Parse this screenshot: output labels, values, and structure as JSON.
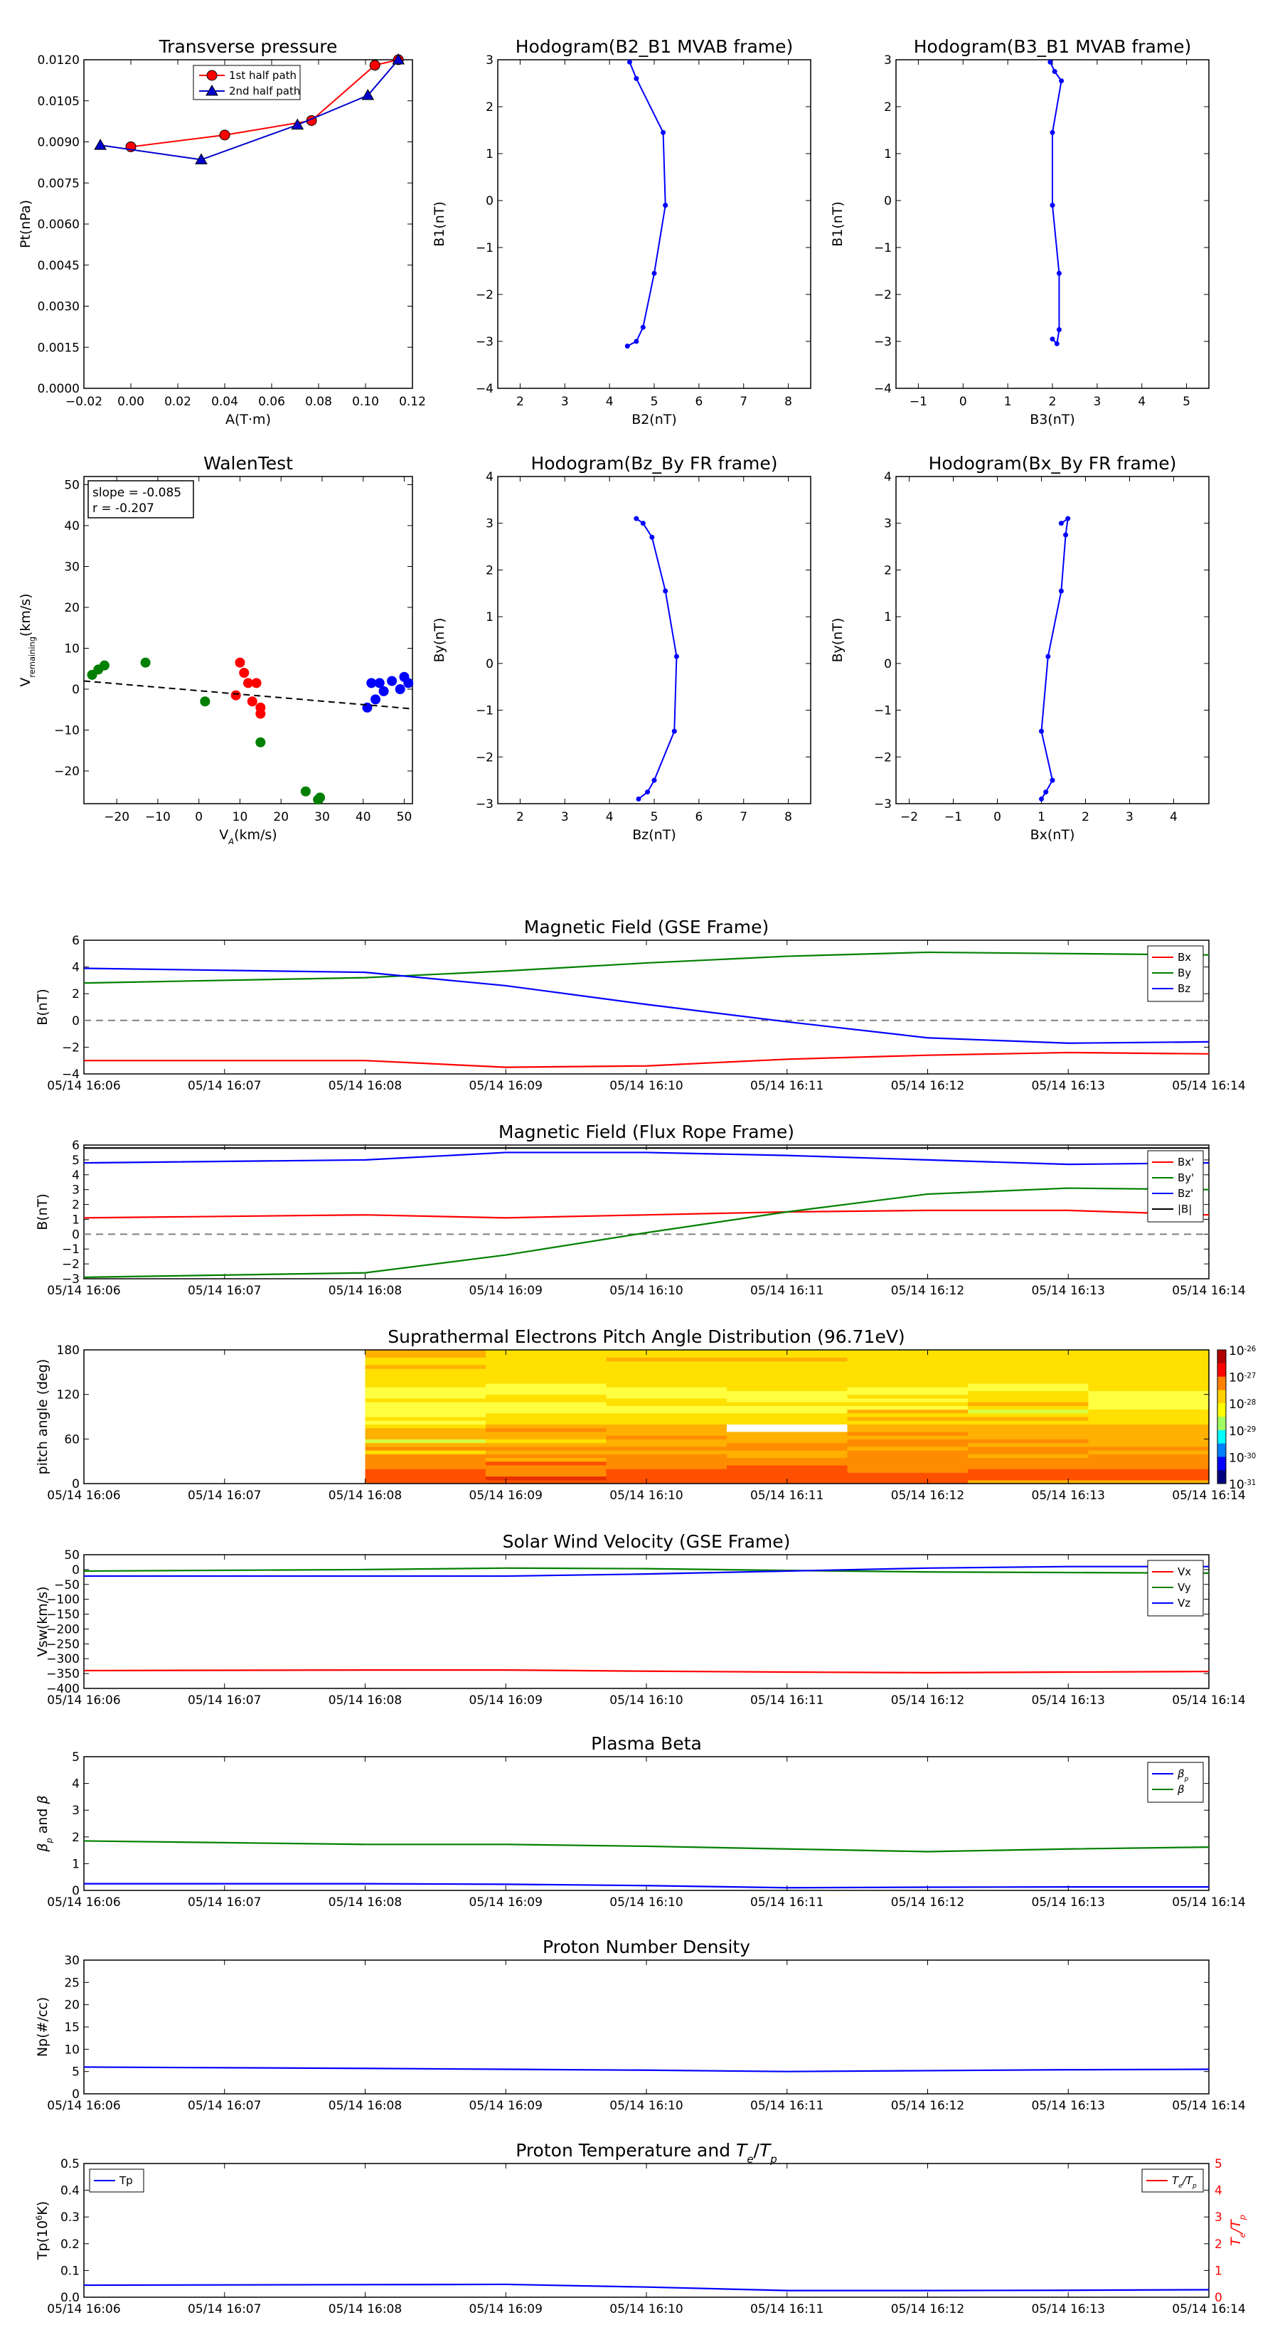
{
  "chart_data": [
    {
      "id": "tp",
      "type": "line",
      "title": "Transverse pressure",
      "xlabel": "A(T·m)",
      "ylabel": "Pt(nPa)",
      "xlim": [
        -0.02,
        0.12
      ],
      "ylim": [
        0,
        0.012
      ],
      "xticks": [
        "−0.02",
        "0.00",
        "0.02",
        "0.04",
        "0.06",
        "0.08",
        "0.10",
        "0.12"
      ],
      "yticks": [
        "0.0000",
        "0.0015",
        "0.0030",
        "0.0045",
        "0.0060",
        "0.0075",
        "0.0090",
        "0.0105",
        "0.0120"
      ],
      "legend": "top-center",
      "series": [
        {
          "name": "1st half path",
          "color": "#ff0000",
          "marker": "circle",
          "x": [
            0.0,
            0.04,
            0.077,
            0.104,
            0.114
          ],
          "y": [
            0.00882,
            0.00925,
            0.00978,
            0.0118,
            0.012
          ]
        },
        {
          "name": "2nd half path",
          "color": "#0000cc",
          "marker": "triangle",
          "x": [
            -0.013,
            0.03,
            0.071,
            0.101,
            0.114
          ],
          "y": [
            0.00888,
            0.00835,
            0.00962,
            0.0107,
            0.012
          ]
        }
      ]
    },
    {
      "id": "hodo1",
      "type": "line",
      "title": "Hodogram(B2_B1 MVAB frame)",
      "xlabel": "B2(nT)",
      "ylabel": "B1(nT)",
      "xlim": [
        1.5,
        8.5
      ],
      "ylim": [
        -4,
        3
      ],
      "xticks": [
        "2",
        "3",
        "4",
        "5",
        "6",
        "7",
        "8"
      ],
      "yticks": [
        "−4",
        "−3",
        "−2",
        "−1",
        "0",
        "1",
        "2",
        "3"
      ],
      "series": [
        {
          "color": "#0000ff",
          "marker": "dot",
          "x": [
            4.4,
            4.6,
            4.75,
            5.0,
            5.25,
            5.2,
            4.6,
            4.45
          ],
          "y": [
            -3.1,
            -3.0,
            -2.7,
            -1.55,
            -0.1,
            1.45,
            2.6,
            2.95
          ]
        }
      ]
    },
    {
      "id": "hodo2",
      "type": "line",
      "title": "Hodogram(B3_B1 MVAB frame)",
      "xlabel": "B3(nT)",
      "ylabel": "B1(nT)",
      "xlim": [
        -1.5,
        5.5
      ],
      "ylim": [
        -4,
        3
      ],
      "xticks": [
        "−1",
        "0",
        "1",
        "2",
        "3",
        "4",
        "5"
      ],
      "yticks": [
        "−4",
        "−3",
        "−2",
        "−1",
        "0",
        "1",
        "2",
        "3"
      ],
      "series": [
        {
          "color": "#0000ff",
          "marker": "dot",
          "x": [
            2.0,
            2.1,
            2.15,
            2.15,
            2.0,
            2.0,
            2.2,
            2.05,
            1.95
          ],
          "y": [
            -2.95,
            -3.05,
            -2.75,
            -1.55,
            -0.1,
            1.45,
            2.55,
            2.75,
            2.95
          ]
        }
      ]
    },
    {
      "id": "walen",
      "type": "scatter",
      "title": "WalenTest",
      "xlabel": "V",
      "xlabel_sub": "A",
      "xlabel_unit": "(km/s)",
      "ylabel": "V",
      "ylabel_sub": "remaining",
      "ylabel_unit": "(km/s)",
      "xlim": [
        -28,
        52
      ],
      "ylim": [
        -28,
        52
      ],
      "xticks": [
        "−20",
        "−10",
        "0",
        "10",
        "20",
        "30",
        "40",
        "50"
      ],
      "yticks": [
        "−20",
        "−10",
        "0",
        "10",
        "20",
        "30",
        "40",
        "50"
      ],
      "annotation": [
        "slope = -0.085",
        "r = -0.207"
      ],
      "fit_line": {
        "x": [
          -28,
          52
        ],
        "y": [
          2.0,
          -4.8
        ]
      },
      "groups": [
        {
          "color": "#007f00",
          "x": [
            -26,
            -24.5,
            -23,
            -13,
            1.5,
            15,
            26,
            29,
            29.5
          ],
          "y": [
            3.5,
            4.8,
            5.8,
            6.5,
            -3,
            -13,
            -25,
            -27,
            -26.5
          ]
        },
        {
          "color": "#ff0000",
          "x": [
            9,
            10,
            11,
            12,
            13,
            14,
            15,
            15
          ],
          "y": [
            -1.5,
            6.5,
            4,
            1.5,
            -3,
            1.5,
            -6,
            -4.5
          ]
        },
        {
          "color": "#0000ff",
          "x": [
            41,
            42,
            43,
            44,
            45,
            47,
            49,
            50,
            51
          ],
          "y": [
            -4.5,
            1.5,
            -2.5,
            1.5,
            -0.5,
            2,
            0,
            3,
            1.5
          ]
        }
      ]
    },
    {
      "id": "hodo3",
      "type": "line",
      "title": "Hodogram(Bz_By FR frame)",
      "xlabel": "Bz(nT)",
      "ylabel": "By(nT)",
      "xlim": [
        1.5,
        8.5
      ],
      "ylim": [
        -3,
        4
      ],
      "xticks": [
        "2",
        "3",
        "4",
        "5",
        "6",
        "7",
        "8"
      ],
      "yticks": [
        "−3",
        "−2",
        "−1",
        "0",
        "1",
        "2",
        "3",
        "4"
      ],
      "series": [
        {
          "color": "#0000ff",
          "marker": "dot",
          "x": [
            4.65,
            4.85,
            5.0,
            5.45,
            5.5,
            5.25,
            4.95,
            4.75,
            4.6
          ],
          "y": [
            -2.9,
            -2.75,
            -2.5,
            -1.45,
            0.15,
            1.55,
            2.7,
            3.0,
            3.1
          ]
        }
      ]
    },
    {
      "id": "hodo4",
      "type": "line",
      "title": "Hodogram(Bx_By FR frame)",
      "xlabel": "Bx(nT)",
      "ylabel": "By(nT)",
      "xlim": [
        -2.3,
        4.8
      ],
      "ylim": [
        -3,
        4
      ],
      "xticks": [
        "−2",
        "−1",
        "0",
        "1",
        "2",
        "3",
        "4"
      ],
      "yticks": [
        "−3",
        "−2",
        "−1",
        "0",
        "1",
        "2",
        "3",
        "4"
      ],
      "series": [
        {
          "color": "#0000ff",
          "marker": "dot",
          "x": [
            1.0,
            1.1,
            1.25,
            1.0,
            1.15,
            1.45,
            1.55,
            1.6,
            1.45
          ],
          "y": [
            -2.9,
            -2.75,
            -2.5,
            -1.45,
            0.15,
            1.55,
            2.75,
            3.1,
            3.0
          ]
        }
      ]
    },
    {
      "id": "bgse",
      "type": "line",
      "title": "Magnetic Field (GSE Frame)",
      "ylabel": "B(nT)",
      "ylim": [
        -4,
        6
      ],
      "yticks": [
        "−4",
        "−2",
        "0",
        "2",
        "4",
        "6"
      ],
      "hline": 0,
      "legend": "top-right",
      "x": [
        0,
        2,
        3,
        4,
        5,
        6,
        7,
        8
      ],
      "series": [
        {
          "name": "Bx",
          "color": "#ff0000",
          "values": [
            -3.0,
            -3.0,
            -3.5,
            -3.4,
            -2.9,
            -2.6,
            -2.4,
            -2.5
          ]
        },
        {
          "name": "By",
          "color": "#008000",
          "values": [
            2.8,
            3.2,
            3.7,
            4.3,
            4.8,
            5.1,
            5.0,
            4.9
          ]
        },
        {
          "name": "Bz",
          "color": "#0000ff",
          "values": [
            3.9,
            3.6,
            2.6,
            1.2,
            -0.1,
            -1.3,
            -1.7,
            -1.6
          ]
        }
      ]
    },
    {
      "id": "bfr",
      "type": "line",
      "title": "Magnetic Field (Flux Rope Frame)",
      "ylabel": "B(nT)",
      "ylim": [
        -3,
        6
      ],
      "yticks": [
        "−3",
        "−2",
        "−1",
        "0",
        "1",
        "2",
        "3",
        "4",
        "5",
        "6"
      ],
      "hline": 0,
      "legend": "top-right",
      "x": [
        0,
        2,
        3,
        4,
        5,
        6,
        7,
        8
      ],
      "series": [
        {
          "name": "Bx'",
          "color": "#ff0000",
          "values": [
            1.1,
            1.3,
            1.1,
            1.3,
            1.5,
            1.6,
            1.6,
            1.3
          ]
        },
        {
          "name": "By'",
          "color": "#008000",
          "values": [
            -2.9,
            -2.6,
            -1.4,
            0.1,
            1.5,
            2.7,
            3.1,
            3.0
          ]
        },
        {
          "name": "Bz'",
          "color": "#0000ff",
          "values": [
            4.8,
            5.0,
            5.5,
            5.5,
            5.3,
            5.0,
            4.7,
            4.8
          ]
        },
        {
          "name": "|B|",
          "color": "#000000",
          "values": [
            5.8,
            5.8,
            5.8,
            5.8,
            5.8,
            5.8,
            5.8,
            5.8
          ]
        }
      ]
    },
    {
      "id": "pad",
      "type": "heatmap",
      "title": "Suprathermal Electrons Pitch Angle Distribution (96.71eV)",
      "ylabel": "pitch angle (deg)",
      "ylim": [
        0,
        180
      ],
      "yticks": [
        "0",
        "60",
        "120",
        "180"
      ],
      "colorbar": {
        "ticks_exp": [
          "-26",
          "-27",
          "-28",
          "-29",
          "-30",
          "-31"
        ],
        "base": "10"
      },
      "x_start": 2,
      "x_end": 8,
      "columns": [
        [
          3,
          3,
          3,
          3,
          4,
          4,
          4,
          4,
          6,
          4,
          5,
          8,
          5,
          5,
          5,
          6,
          7,
          6,
          7,
          7,
          7,
          7,
          6,
          7,
          7,
          7,
          6,
          6,
          6,
          6,
          6,
          5,
          6,
          6,
          5,
          5
        ],
        [
          3,
          2,
          4,
          4,
          4,
          3,
          5,
          4,
          5,
          4,
          5,
          6,
          5,
          5,
          4,
          5,
          6,
          6,
          6,
          7,
          7,
          7,
          6,
          6,
          7,
          7,
          7,
          6,
          6,
          6,
          6,
          6,
          6,
          6,
          6,
          6
        ],
        [
          3,
          3,
          3,
          3,
          4,
          4,
          4,
          4,
          5,
          4,
          5,
          5,
          4,
          5,
          5,
          5,
          6,
          6,
          6,
          7,
          7,
          6,
          6,
          7,
          7,
          7,
          6,
          6,
          6,
          6,
          6,
          6,
          6,
          5,
          6,
          6
        ],
        [
          3,
          3,
          3,
          3,
          3,
          4,
          4,
          5,
          5,
          4,
          4,
          5,
          5,
          5,
          -1,
          -1,
          6,
          6,
          6,
          7,
          7,
          6,
          7,
          7,
          7,
          6,
          6,
          6,
          6,
          6,
          6,
          6,
          6,
          5,
          6,
          6
        ],
        [
          3,
          3,
          3,
          4,
          4,
          4,
          4,
          4,
          4,
          5,
          4,
          4,
          5,
          4,
          5,
          5,
          6,
          5,
          6,
          5,
          7,
          6,
          7,
          6,
          7,
          7,
          6,
          6,
          6,
          6,
          6,
          6,
          6,
          6,
          6,
          6
        ],
        [
          5,
          3,
          3,
          3,
          4,
          4,
          4,
          5,
          4,
          4,
          5,
          4,
          5,
          5,
          5,
          5,
          6,
          5,
          6,
          8,
          6,
          5,
          6,
          6,
          6,
          7,
          7,
          6,
          6,
          6,
          6,
          6,
          6,
          6,
          6,
          6
        ],
        [
          5,
          3,
          3,
          3,
          4,
          4,
          4,
          4,
          5,
          4,
          5,
          5,
          5,
          5,
          5,
          5,
          6,
          6,
          6,
          6,
          7,
          7,
          7,
          7,
          7,
          6,
          6,
          6,
          6,
          6,
          6,
          6,
          6,
          6,
          6,
          6
        ]
      ]
    },
    {
      "id": "vsw",
      "type": "line",
      "title": "Solar Wind Velocity (GSE Frame)",
      "ylabel": "Vsw(km/s)",
      "ylim": [
        -400,
        50
      ],
      "yticks": [
        "−400",
        "−350",
        "−300",
        "−250",
        "−200",
        "−150",
        "−100",
        "−50",
        "0",
        "50"
      ],
      "legend": "top-right",
      "x": [
        0,
        2,
        3,
        4,
        5,
        6,
        7,
        8
      ],
      "series": [
        {
          "name": "Vx",
          "color": "#ff0000",
          "values": [
            -340,
            -338,
            -338,
            -342,
            -345,
            -347,
            -345,
            -343
          ]
        },
        {
          "name": "Vy",
          "color": "#008000",
          "values": [
            -5,
            0,
            5,
            3,
            -3,
            -8,
            -10,
            -12
          ]
        },
        {
          "name": "Vz",
          "color": "#0000ff",
          "values": [
            -22,
            -22,
            -22,
            -15,
            -5,
            5,
            10,
            10
          ]
        }
      ]
    },
    {
      "id": "beta",
      "type": "line",
      "title": "Plasma Beta",
      "ylabel": "β",
      "ylabel_sub": "p",
      "ylabel_mid": " and ",
      "ylabel_end": "β",
      "ylim": [
        0,
        5
      ],
      "yticks": [
        "0",
        "1",
        "2",
        "3",
        "4",
        "5"
      ],
      "legend": "top-right",
      "x": [
        0,
        2,
        3,
        4,
        5,
        6,
        7,
        8
      ],
      "series": [
        {
          "name": "β",
          "name_sub": "p",
          "color": "#0000ff",
          "values": [
            0.25,
            0.25,
            0.23,
            0.18,
            0.1,
            0.12,
            0.13,
            0.13
          ]
        },
        {
          "name": "β",
          "color": "#008000",
          "values": [
            1.85,
            1.72,
            1.72,
            1.65,
            1.55,
            1.45,
            1.55,
            1.62
          ]
        }
      ]
    },
    {
      "id": "np",
      "type": "line",
      "title": "Proton Number Density",
      "ylabel": "Np(#/cc)",
      "ylim": [
        0,
        30
      ],
      "yticks": [
        "0",
        "5",
        "10",
        "15",
        "20",
        "25",
        "30"
      ],
      "x": [
        0,
        2,
        3,
        4,
        5,
        6,
        7,
        8
      ],
      "series": [
        {
          "color": "#0000ff",
          "values": [
            6.0,
            5.7,
            5.5,
            5.3,
            5.0,
            5.2,
            5.4,
            5.5
          ]
        }
      ]
    },
    {
      "id": "temp",
      "type": "line",
      "title": "Proton Temperature and ",
      "title_math": "T",
      "title_math_sub": "e",
      "title_slash": "/",
      "title_math2": "T",
      "title_math2_sub": "p",
      "ylabel": "Tp(10",
      "ylabel_sup": "6",
      "ylabel_end": "K)",
      "ylim": [
        0,
        0.5
      ],
      "yticks": [
        "0.0",
        "0.1",
        "0.2",
        "0.3",
        "0.4",
        "0.5"
      ],
      "y2ticks": [
        "0",
        "1",
        "2",
        "3",
        "4",
        "5"
      ],
      "y2label": "T",
      "y2label_sub": "e",
      "y2label_end": "/T",
      "y2label_sub2": "p",
      "x": [
        0,
        2,
        3,
        4,
        5,
        6,
        7,
        8
      ],
      "series": [
        {
          "name": "Tp",
          "color": "#0000ff",
          "values": [
            0.045,
            0.047,
            0.048,
            0.038,
            0.025,
            0.025,
            0.026,
            0.028
          ]
        }
      ],
      "series2": [
        {
          "name": "T",
          "name_sub": "e",
          "name_end": "/T",
          "name_sub2": "p",
          "color": "#ff0000",
          "values": []
        }
      ]
    }
  ],
  "time_ticks": [
    "05/14 16:06",
    "05/14 16:07",
    "05/14 16:08",
    "05/14 16:09",
    "05/14 16:10",
    "05/14 16:11",
    "05/14 16:12",
    "05/14 16:13",
    "05/14 16:14"
  ]
}
